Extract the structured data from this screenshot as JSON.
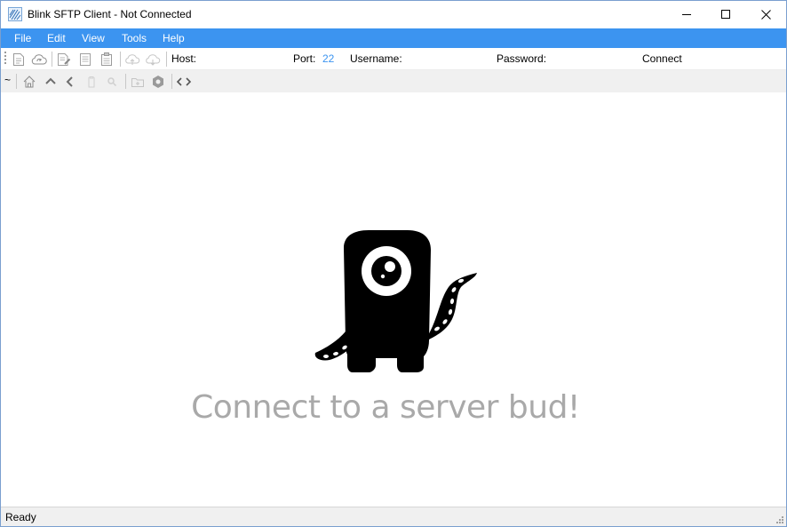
{
  "window": {
    "title": "Blink SFTP Client - Not Connected",
    "controls": {
      "minimize": "minimize-icon",
      "maximize": "maximize-icon",
      "close": "close-icon"
    }
  },
  "menu": {
    "items": [
      {
        "label": "File"
      },
      {
        "label": "Edit"
      },
      {
        "label": "View"
      },
      {
        "label": "Tools"
      },
      {
        "label": "Help"
      }
    ]
  },
  "connection_bar": {
    "host_label": "Host:",
    "host_value": "",
    "port_label": "Port:",
    "port_value": "22",
    "username_label": "Username:",
    "username_value": "",
    "password_label": "Password:",
    "password_value": "",
    "connect_label": "Connect"
  },
  "toolbar": {
    "file_icons": [
      "new-file-icon",
      "cloud-sync-icon",
      "edit-file-icon",
      "copy-icon",
      "paste-icon",
      "upload-icon",
      "download-icon"
    ],
    "nav_icons": [
      "home-icon",
      "up-icon",
      "back-icon",
      "delete-icon",
      "search-icon",
      "new-folder-icon",
      "settings-icon",
      "code-view-icon"
    ],
    "path_prefix": "~"
  },
  "main": {
    "empty_message": "Connect to a server bud!",
    "mascot": "one-eyed-monster-mascot"
  },
  "status": {
    "text": "Ready"
  },
  "colors": {
    "accent": "#3c94f0",
    "placeholder_text": "#a9a9a9",
    "status_bar": "#f0f0f0"
  }
}
